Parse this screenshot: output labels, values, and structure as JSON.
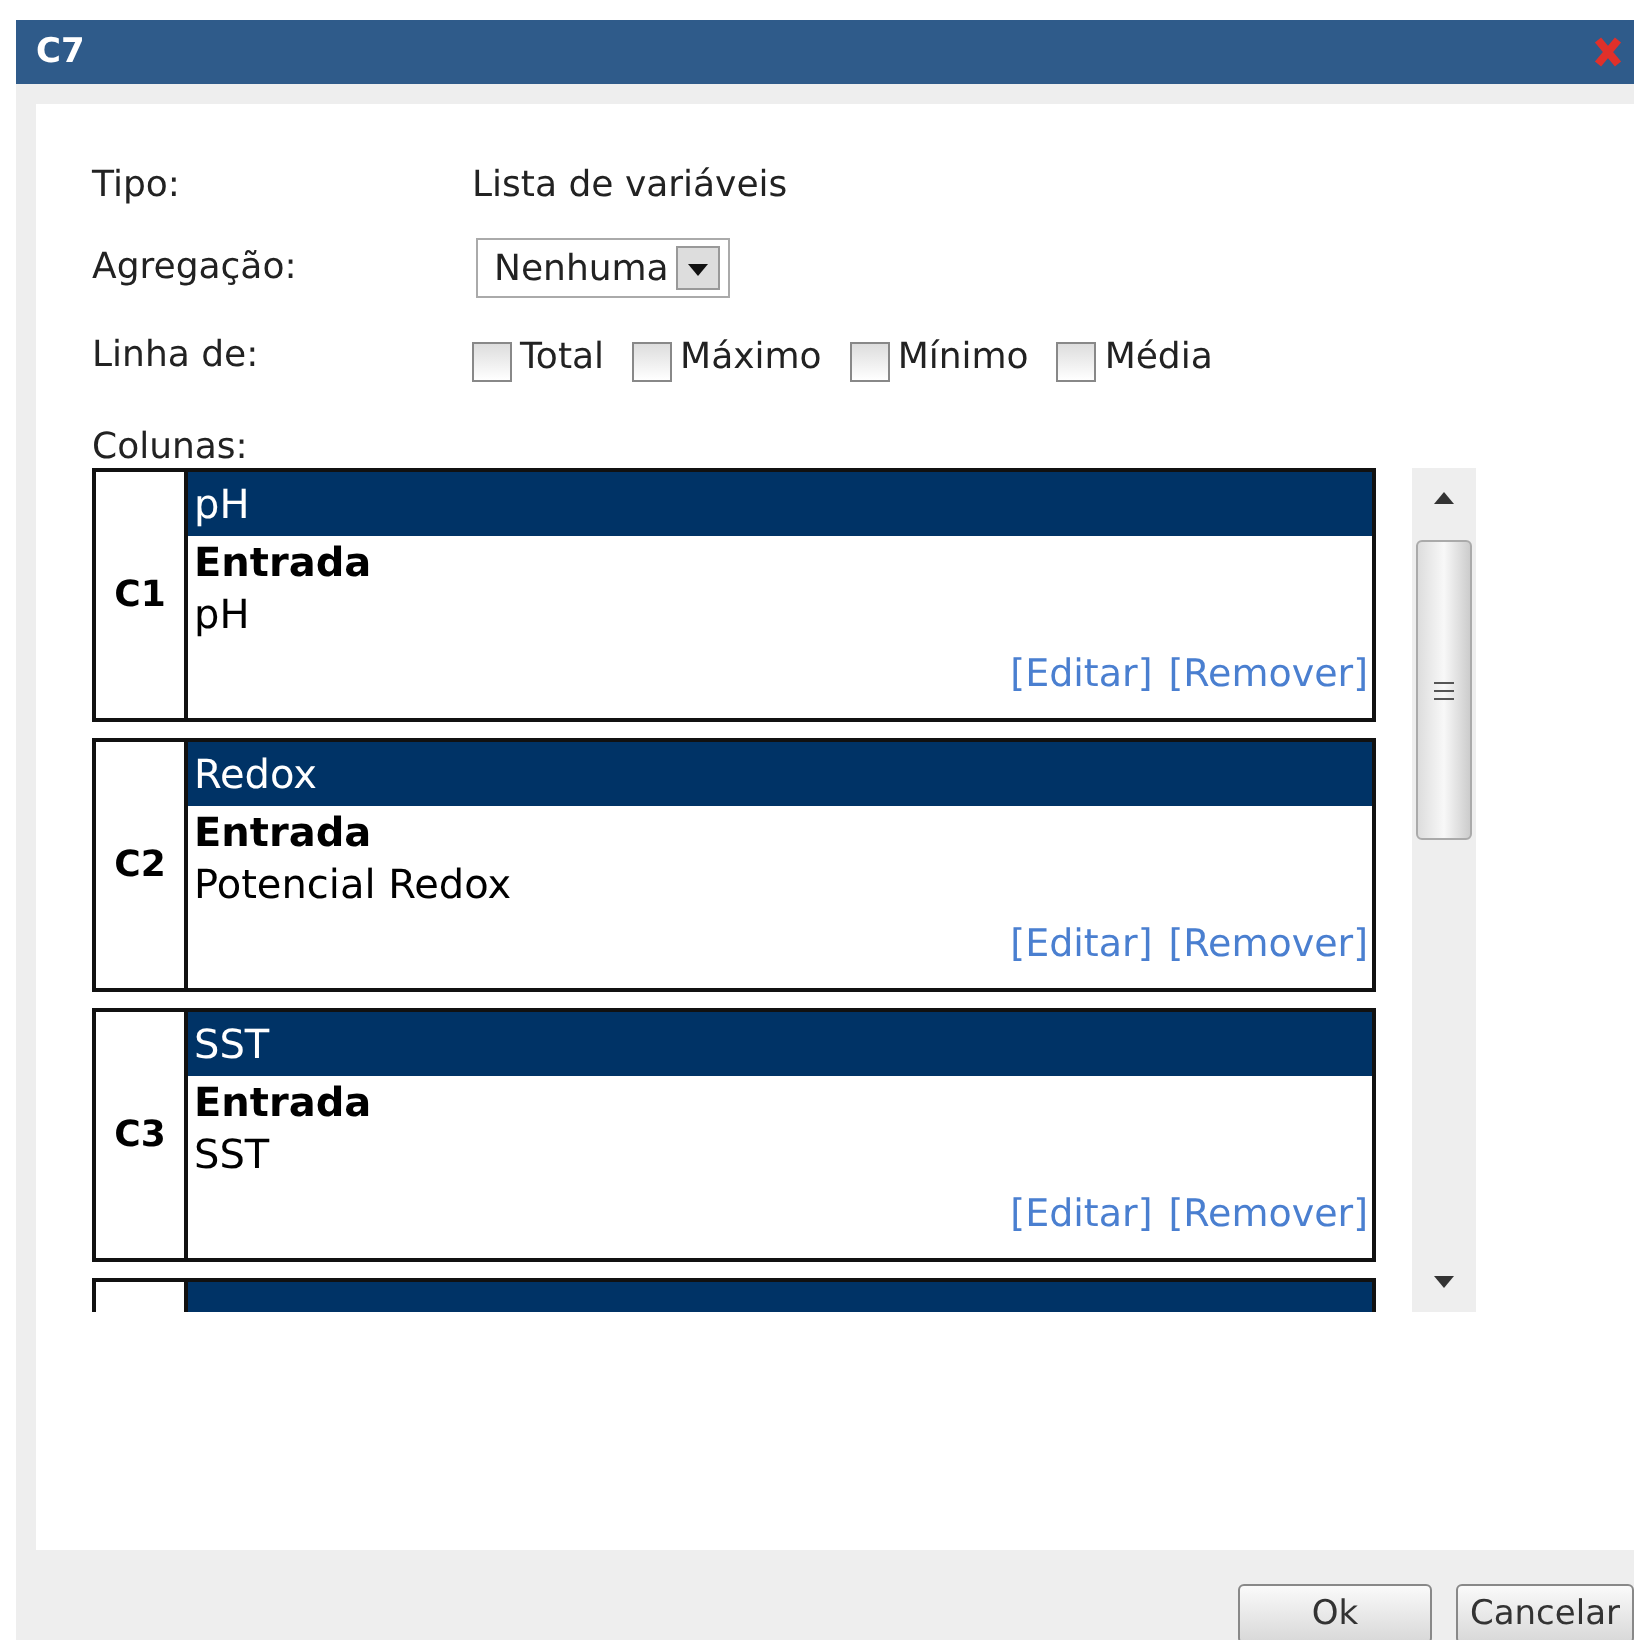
{
  "window": {
    "title": "C7"
  },
  "fields": [
    {
      "label": "Tipo:",
      "value": "Lista de variáveis"
    }
  ],
  "aggregation": {
    "label": "Agregação:",
    "value": "Nenhuma"
  },
  "line_of": {
    "label": "Linha de:",
    "options": [
      {
        "label": "Total",
        "checked": false
      },
      {
        "label": "Máximo",
        "checked": false
      },
      {
        "label": "Mínimo",
        "checked": false
      },
      {
        "label": "Média",
        "checked": false
      }
    ]
  },
  "columns": {
    "label": "Colunas:",
    "items": [
      {
        "code": "C1",
        "name": "pH",
        "kind_label": "Entrada",
        "variable": "pH",
        "links": [
          "[Editar]",
          "[Remover]"
        ]
      },
      {
        "code": "C2",
        "name": "Redox",
        "kind_label": "Entrada",
        "variable": "Potencial Redox",
        "links": [
          "[Editar]",
          "[Remover]"
        ]
      },
      {
        "code": "C3",
        "name": "SST",
        "kind_label": "Entrada",
        "variable": "SST",
        "links": [
          "[Editar]",
          "[Remover]"
        ]
      }
    ]
  },
  "buttons": [
    "Ok",
    "Cancelar"
  ]
}
